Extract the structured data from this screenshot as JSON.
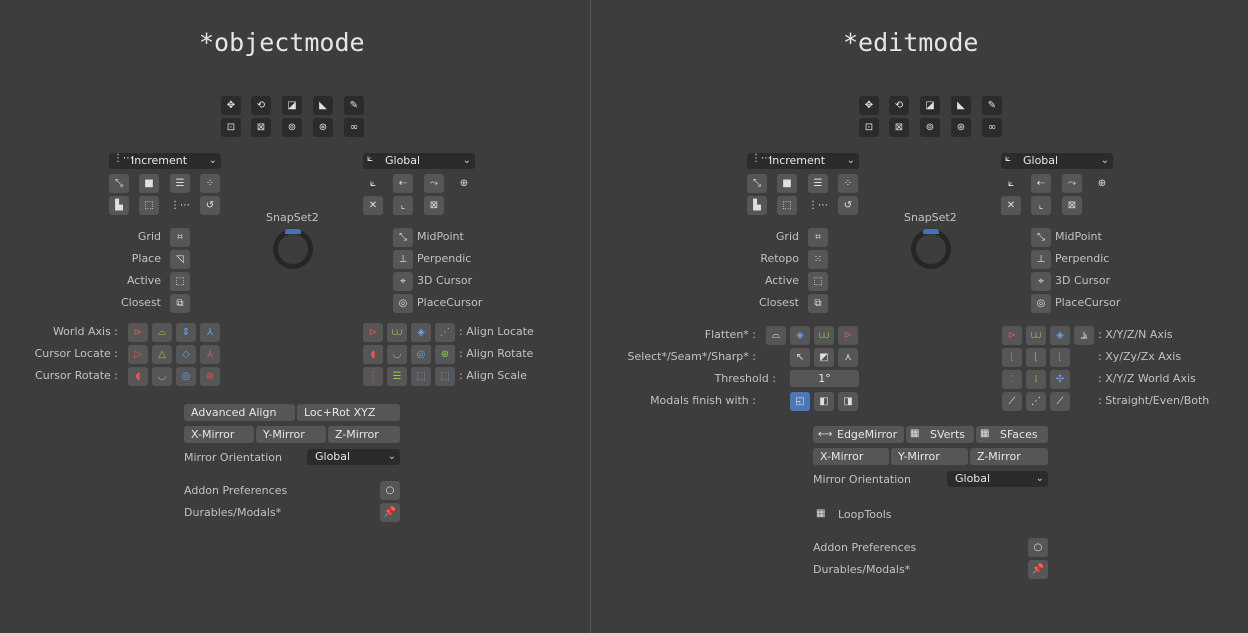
{
  "left": {
    "title": "*objectmode",
    "snap_element": "Increment",
    "orientation": "Global",
    "snapset_label": "SnapSet2",
    "snap_targets_left": [
      "Grid",
      "Place",
      "Active",
      "Closest"
    ],
    "snap_targets_right": [
      "MidPoint",
      "Perpendic",
      "3D Cursor",
      "PlaceCursor"
    ],
    "axis_rows_left": [
      "World Axis :",
      "Cursor Locate :",
      "Cursor Rotate :"
    ],
    "axis_rows_right": [
      ": Align Locate",
      ": Align Rotate",
      ": Align Scale"
    ],
    "advanced_align": "Advanced Align",
    "loc_rot": "Loc+Rot XYZ",
    "x_mirror": "X-Mirror",
    "y_mirror": "Y-Mirror",
    "z_mirror": "Z-Mirror",
    "mirror_orientation_label": "Mirror Orientation",
    "mirror_orientation_value": "Global",
    "addon_prefs": "Addon Preferences",
    "durables": "Durables/Modals*"
  },
  "right": {
    "title": "*editmode",
    "snap_element": "Increment",
    "orientation": "Global",
    "snapset_label": "SnapSet2",
    "snap_targets_left": [
      "Grid",
      "Retopo",
      "Active",
      "Closest"
    ],
    "snap_targets_right": [
      "MidPoint",
      "Perpendic",
      "3D Cursor",
      "PlaceCursor"
    ],
    "flatten_label": "Flatten* :",
    "select_label": "Select*/Seam*/Sharp* :",
    "threshold_label": "Threshold :",
    "threshold_value": "1°",
    "modals_label": "Modals finish with :",
    "axis_right": [
      ": X/Y/Z/N Axis",
      ": Xy/Zy/Zx Axis",
      ": X/Y/Z World Axis",
      ": Straight/Even/Both"
    ],
    "edge_mirror": "EdgeMirror",
    "sverts": "SVerts",
    "sfaces": "SFaces",
    "x_mirror": "X-Mirror",
    "y_mirror": "Y-Mirror",
    "z_mirror": "Z-Mirror",
    "mirror_orientation_label": "Mirror Orientation",
    "mirror_orientation_value": "Global",
    "looptools": "LoopTools",
    "addon_prefs": "Addon Preferences",
    "durables": "Durables/Modals*"
  },
  "colors": {
    "background": "#3d3d3d",
    "button": "#565656",
    "dark": "#2b2b2b",
    "accent": "#4a77b8"
  }
}
